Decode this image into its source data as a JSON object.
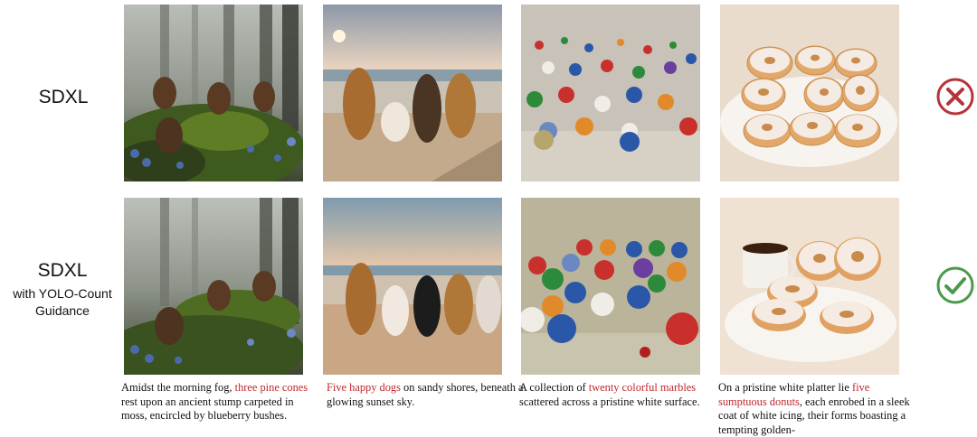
{
  "rows": [
    {
      "label_main": "SDXL",
      "label_sub_1": "",
      "label_sub_2": ""
    },
    {
      "label_main": "SDXL",
      "label_sub_1": "with YOLO-Count",
      "label_sub_2": "Guidance"
    }
  ],
  "captions": [
    {
      "pre": "Amidst the morning fog, ",
      "highlight": "three pine cones",
      "post": " rest upon an ancient stump carpeted in moss, encircled by blueberry bushes."
    },
    {
      "pre": "",
      "highlight": "Five happy dogs",
      "post": " on sandy shores, beneath a glowing sunset sky."
    },
    {
      "pre": "A collection of ",
      "highlight": "twenty colorful marbles",
      "post": " scattered across a pristine white surface."
    },
    {
      "pre": "On a pristine white platter lie ",
      "highlight": "five sumptuous donuts",
      "post": ", each enrobed in a sleek coat of white icing, their forms boasting a tempting golden-"
    }
  ],
  "status": {
    "row1": {
      "icon": "cross-circle-icon",
      "color": "#b8323a"
    },
    "row2": {
      "icon": "check-circle-icon",
      "color": "#4a9a4a"
    }
  },
  "colors": {
    "highlight": "#c0272d"
  }
}
